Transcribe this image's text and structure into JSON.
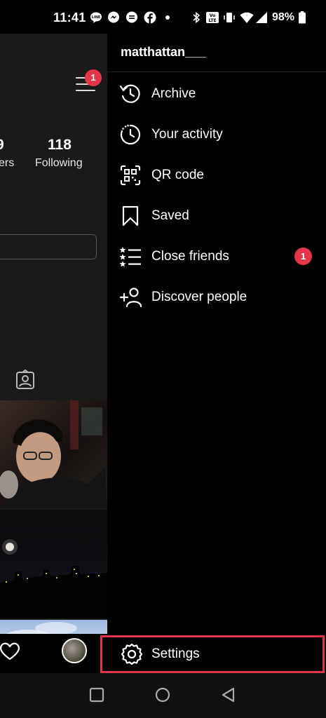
{
  "status_bar": {
    "time": "11:41",
    "battery": "98%",
    "icons": [
      "line-icon",
      "messenger-icon",
      "chat-icon",
      "facebook-icon",
      "dot-icon",
      "bluetooth-icon",
      "volte-icon",
      "vibrate-icon",
      "wifi-icon",
      "signal-icon",
      "battery-icon"
    ]
  },
  "profile": {
    "menu_badge": "1",
    "followers_count_partial": "9",
    "followers_label_partial": "ers",
    "following_count": "118",
    "following_label": "Following"
  },
  "drawer": {
    "username": "matthattan___",
    "items": [
      {
        "label": "Archive",
        "icon": "archive-icon"
      },
      {
        "label": "Your activity",
        "icon": "activity-icon"
      },
      {
        "label": "QR code",
        "icon": "qr-code-icon"
      },
      {
        "label": "Saved",
        "icon": "bookmark-icon"
      },
      {
        "label": "Close friends",
        "icon": "close-friends-icon",
        "badge": "1"
      },
      {
        "label": "Discover people",
        "icon": "add-person-icon"
      }
    ],
    "settings_label": "Settings"
  },
  "colors": {
    "badge": "#e5354a",
    "highlight_border": "#e0354a",
    "background": "#000000",
    "profile_panel": "#1a1a1a"
  }
}
